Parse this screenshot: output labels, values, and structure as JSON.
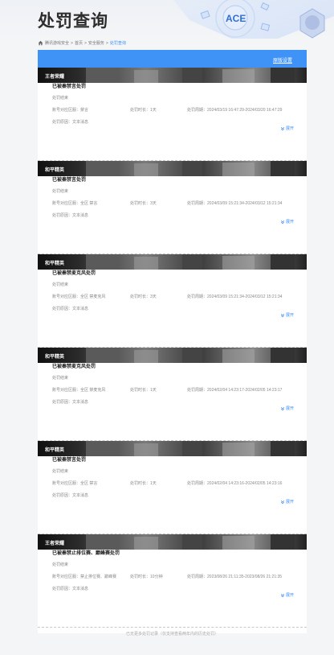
{
  "page": {
    "title": "处罚查询",
    "breadcrumb": [
      "腾讯游戏安全",
      "首页",
      "安全服务",
      "处罚查询"
    ],
    "top_link": "原版设置",
    "footer": "已无更多处罚记录（仅支持查看两年内的历史处罚）"
  },
  "labels": {
    "related_account": "账号对应区服：",
    "duration": "处罚时长：",
    "period": "处罚周期：",
    "reason": "处罚原因：",
    "expand": "展开"
  },
  "cards": [
    {
      "game": "王者荣耀",
      "title": "已被秦禁言处罚",
      "status": "处罚结束",
      "account": "禁言",
      "duration": "1天",
      "period": "2024/03/19 16:47:29-2024/03/20 16:47:29",
      "reason": "文本消息"
    },
    {
      "game": "和平精英",
      "title": "已被秦禁言处罚",
      "status": "处罚结束",
      "account": "全区 禁言",
      "duration": "3天",
      "period": "2024/03/09 15:21:34-2024/03/12 15:21:34",
      "reason": "文本消息"
    },
    {
      "game": "和平精英",
      "title": "已被秦禁麦克风处罚",
      "status": "处罚结束",
      "account": "全区 禁麦克风",
      "duration": "3天",
      "period": "2024/03/09 15:21:34-2024/03/12 15:21:34",
      "reason": "文本消息"
    },
    {
      "game": "和平精英",
      "title": "已被秦禁麦克风处罚",
      "status": "处罚结束",
      "account": "全区 禁麦克风",
      "duration": "1天",
      "period": "2024/02/04 14:23:17-2024/02/05 14:23:17",
      "reason": "文本消息"
    },
    {
      "game": "和平精英",
      "title": "已被秦禁言处罚",
      "status": "处罚结束",
      "account": "全区 禁言",
      "duration": "1天",
      "period": "2024/02/04 14:23:16-2024/02/05 14:23:16",
      "reason": "文本消息"
    },
    {
      "game": "王者荣耀",
      "title": "已被秦禁止排位赛、巅峰赛处罚",
      "status": "处罚结束",
      "account": "禁止排位赛、巅峰赛",
      "duration": "10分钟",
      "period": "2023/08/26 21:11:35-2023/08/26 21:21:35",
      "reason": "文本消息"
    }
  ]
}
